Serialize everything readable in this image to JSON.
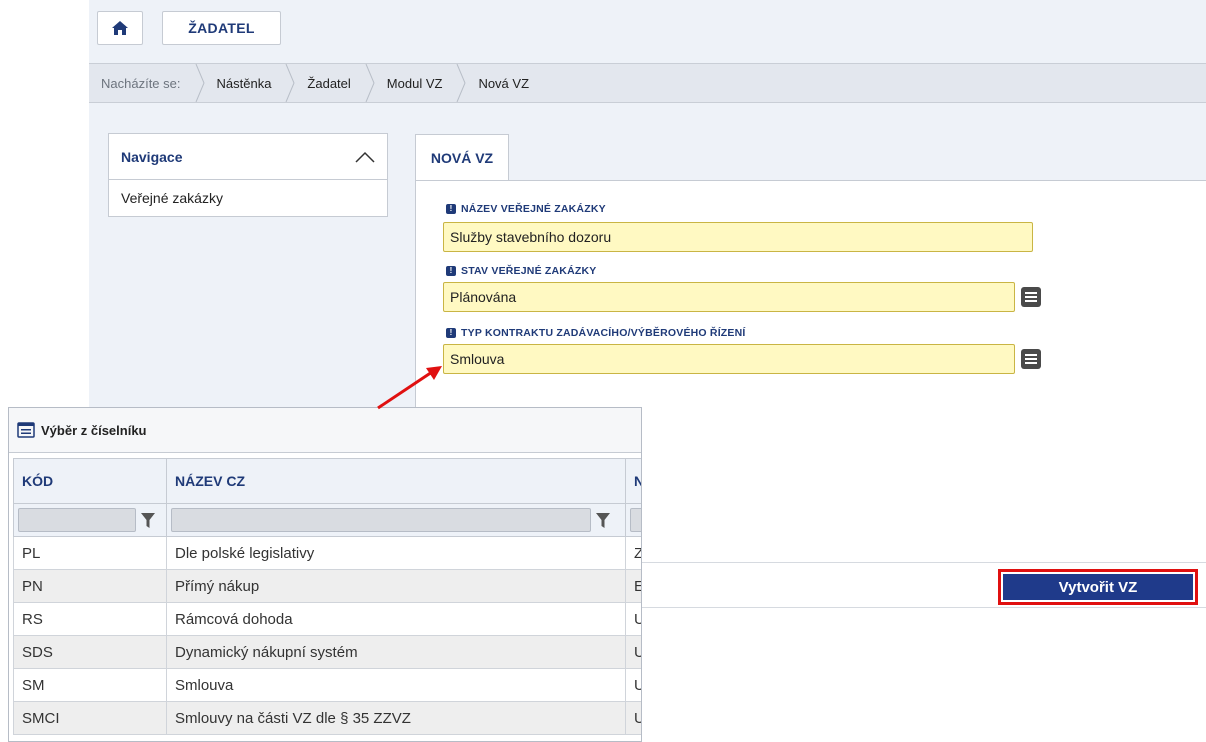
{
  "topbar": {
    "home_icon": "home-icon",
    "zadatel_label": "ŽADATEL"
  },
  "breadcrumb": {
    "prefix": "Nacházíte se:",
    "items": [
      "Nástěnka",
      "Žadatel",
      "Modul VZ",
      "Nová VZ"
    ]
  },
  "navigation": {
    "title": "Navigace",
    "collapse_icon": "chevron-up-icon",
    "items": [
      "Veřejné zakázky"
    ]
  },
  "tab": {
    "label": "NOVÁ VZ"
  },
  "form": {
    "fields": [
      {
        "label": "NÁZEV VEŘEJNÉ ZAKÁZKY",
        "value": "Služby stavebního dozoru"
      },
      {
        "label": "STAV VEŘEJNÉ ZAKÁZKY",
        "value": "Plánována"
      },
      {
        "label": "TYP KONTRAKTU ZADÁVACÍHO/VÝBĚROVÉHO ŘÍZENÍ",
        "value": "Smlouva"
      }
    ],
    "required_icon": "exclamation-icon",
    "list_icon": "list-icon",
    "create_button": "Vytvořit VZ"
  },
  "popup": {
    "title": "Výběr z číselníku",
    "title_icon": "list-window-icon",
    "columns": [
      "KÓD",
      "NÁZEV CZ",
      "N"
    ],
    "filter_icon": "filter-icon",
    "rows": [
      {
        "kod": "PL",
        "nazev": "Dle polské legislativy",
        "n": "Z"
      },
      {
        "kod": "PN",
        "nazev": "Přímý nákup",
        "n": "E"
      },
      {
        "kod": "RS",
        "nazev": "Rámcová dohoda",
        "n": "U"
      },
      {
        "kod": "SDS",
        "nazev": "Dynamický nákupní systém",
        "n": "U"
      },
      {
        "kod": "SM",
        "nazev": "Smlouva",
        "n": "U"
      },
      {
        "kod": "SMCI",
        "nazev": "Smlouvy na části VZ dle § 35 ZZVZ",
        "n": "U"
      }
    ]
  },
  "colors": {
    "accent": "#1f3a78",
    "highlight": "#e01010",
    "input_bg": "#fff9c2"
  }
}
